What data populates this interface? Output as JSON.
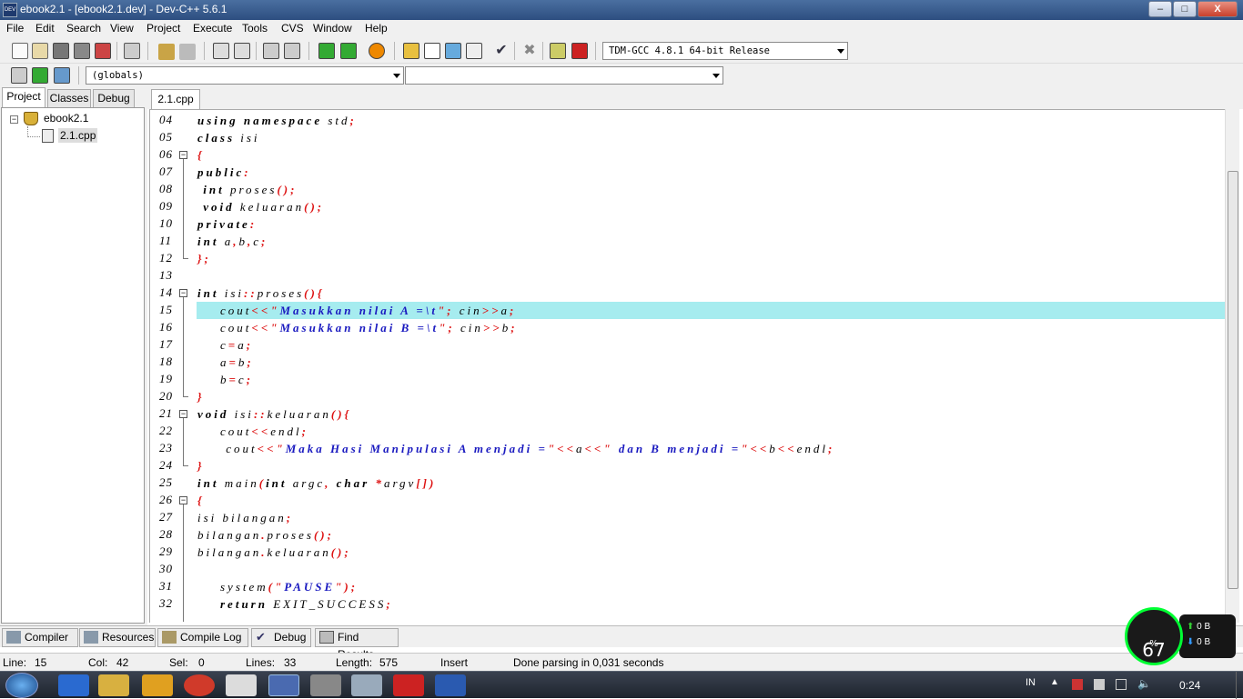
{
  "window": {
    "title": "ebook2.1 - [ebook2.1.dev] - Dev-C++ 5.6.1",
    "app_icon_text": "DEV",
    "min": "–",
    "max": "□",
    "close": "X"
  },
  "menu": [
    "File",
    "Edit",
    "Search",
    "View",
    "Project",
    "Execute",
    "Tools",
    "CVS",
    "Window",
    "Help"
  ],
  "toolbar": {
    "compiler_select": "TDM-GCC 4.8.1 64-bit Release"
  },
  "toolbar2": {
    "scope_select": "(globals)",
    "member_select": ""
  },
  "left_tabs": [
    "Project",
    "Classes",
    "Debug"
  ],
  "tree": {
    "project": "ebook2.1",
    "file": "2.1.cpp"
  },
  "editor_tab": "2.1.cpp",
  "lines": [
    {
      "n": "04",
      "t": "using namespace std;"
    },
    {
      "n": "05",
      "t": "class isi"
    },
    {
      "n": "06",
      "t": "{"
    },
    {
      "n": "07",
      "t": "public:"
    },
    {
      "n": "08",
      "t": " int proses();"
    },
    {
      "n": "09",
      "t": " void keluaran();"
    },
    {
      "n": "10",
      "t": "private:"
    },
    {
      "n": "11",
      "t": "int a,b,c;"
    },
    {
      "n": "12",
      "t": "};"
    },
    {
      "n": "13",
      "t": ""
    },
    {
      "n": "14",
      "t": "int isi::proses(){"
    },
    {
      "n": "15",
      "t": "    cout<<\"Masukkan nilai A =\\t\"; cin>>a;"
    },
    {
      "n": "16",
      "t": "    cout<<\"Masukkan nilai B =\\t\"; cin>>b;"
    },
    {
      "n": "17",
      "t": "    c=a;"
    },
    {
      "n": "18",
      "t": "    a=b;"
    },
    {
      "n": "19",
      "t": "    b=c;"
    },
    {
      "n": "20",
      "t": "}"
    },
    {
      "n": "21",
      "t": "void isi::keluaran(){"
    },
    {
      "n": "22",
      "t": "    cout<<endl;"
    },
    {
      "n": "23",
      "t": "     cout<<\"Maka Hasi Manipulasi A menjadi =\"<<a<<\" dan B menjadi =\"<<b<<endl;"
    },
    {
      "n": "24",
      "t": "}"
    },
    {
      "n": "25",
      "t": "int main(int argc, char *argv[])"
    },
    {
      "n": "26",
      "t": "{"
    },
    {
      "n": "27",
      "t": "isi bilangan;"
    },
    {
      "n": "28",
      "t": "bilangan.proses();"
    },
    {
      "n": "29",
      "t": "bilangan.keluaran();"
    },
    {
      "n": "30",
      "t": ""
    },
    {
      "n": "31",
      "t": "    system(\"PAUSE\");"
    },
    {
      "n": "32",
      "t": "    return EXIT_SUCCESS;"
    }
  ],
  "bottom_tabs": [
    "Compiler",
    "Resources",
    "Compile Log",
    "Debug",
    "Find Results"
  ],
  "status": {
    "line_label": "Line:",
    "line": "15",
    "col_label": "Col:",
    "col": "42",
    "sel_label": "Sel:",
    "sel": "0",
    "lines_label": "Lines:",
    "lines": "33",
    "length_label": "Length:",
    "length": "575",
    "mode": "Insert",
    "message": "Done parsing in 0,031 seconds"
  },
  "net": {
    "percent": "67",
    "pct_sign": "%",
    "up": "0 B",
    "down": "0 B"
  },
  "tray": {
    "lang": "IN",
    "clock": "0:24"
  },
  "colors": {
    "highlight": "#a6ecef",
    "keyword": "#000000",
    "string": "#1a1ac0",
    "punct": "#dd1111"
  }
}
